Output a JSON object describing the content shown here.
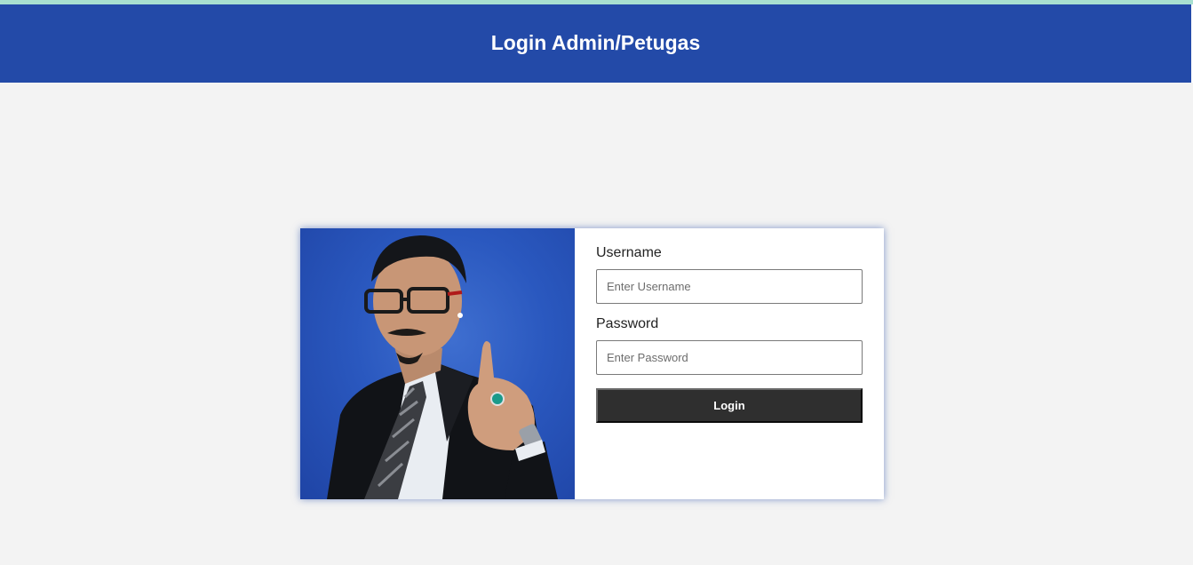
{
  "header": {
    "title": "Login Admin/Petugas"
  },
  "form": {
    "username": {
      "label": "Username",
      "placeholder": "Enter Username",
      "value": ""
    },
    "password": {
      "label": "Password",
      "placeholder": "Enter Password",
      "value": ""
    },
    "login_label": "Login"
  },
  "colors": {
    "header_bg": "#234aa8",
    "top_accent": "#a8e0d0",
    "page_bg": "#f3f3f3",
    "button_bg": "#2f2f2f",
    "photo_bg": "#2a58bf"
  },
  "photo": {
    "description_icon": "person-photo"
  }
}
